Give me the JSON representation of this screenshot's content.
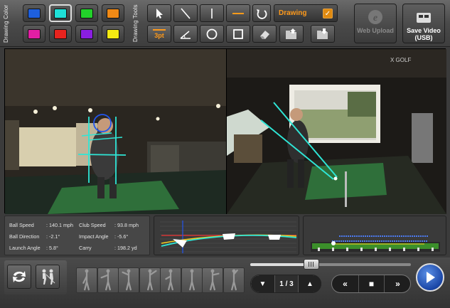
{
  "toolbar": {
    "drawing_color_label": "Drawing Color",
    "drawing_tools_label": "Drawing Tools",
    "colors": [
      {
        "name": "blue",
        "hex": "#1e5fdc"
      },
      {
        "name": "cyan",
        "hex": "#1ee0d8",
        "selected": true
      },
      {
        "name": "green",
        "hex": "#22d12a"
      },
      {
        "name": "orange",
        "hex": "#f08a16"
      },
      {
        "name": "magenta",
        "hex": "#e21ea4"
      },
      {
        "name": "red",
        "hex": "#e8231e"
      },
      {
        "name": "purple",
        "hex": "#8a1ee0"
      },
      {
        "name": "yellow",
        "hex": "#f4ea12"
      }
    ],
    "tools": [
      "select-arrow",
      "diagonal-line",
      "vertical-line",
      "horizontal-line",
      "undo",
      "stroke-width",
      "angle",
      "circle",
      "rectangle",
      "eraser",
      "load-drawing",
      "save-drawing"
    ],
    "stroke_width_label": "3pt",
    "drawing_toggle_label": "Drawing",
    "drawing_checked_mark": "✓",
    "web_upload_label": "Web Upload",
    "save_video_label": "Save Video (USB)"
  },
  "video": {
    "left_brand": "",
    "right_brand": "X GOLF"
  },
  "stats": {
    "ball_speed_label": "Ball Speed",
    "ball_speed_value": ": 140.1 mph",
    "ball_direction_label": "Ball Direction",
    "ball_direction_value": ": -2.1°",
    "launch_angle_label": "Launch Angle",
    "launch_angle_value": ": 5.8°",
    "club_speed_label": "Club Speed",
    "club_speed_value": ": 93.8 mph",
    "impact_angle_label": "Impact Angle",
    "impact_angle_value": ": -5.6°",
    "carry_label": "Carry",
    "carry_value": ": 198.2 yd"
  },
  "playback": {
    "frame_counter": "1 / 3",
    "prev_symbol": "▼",
    "next_symbol": "▲",
    "rewind_symbol": "«",
    "stop_symbol": "■",
    "ffwd_symbol": "»",
    "scrub_position": 0.38
  },
  "colors": {
    "accent_orange": "#ff9a1a",
    "overlay_cyan": "#2ee6d6",
    "overlay_blue": "#2255ee",
    "play_blue": "#1a46a6"
  }
}
